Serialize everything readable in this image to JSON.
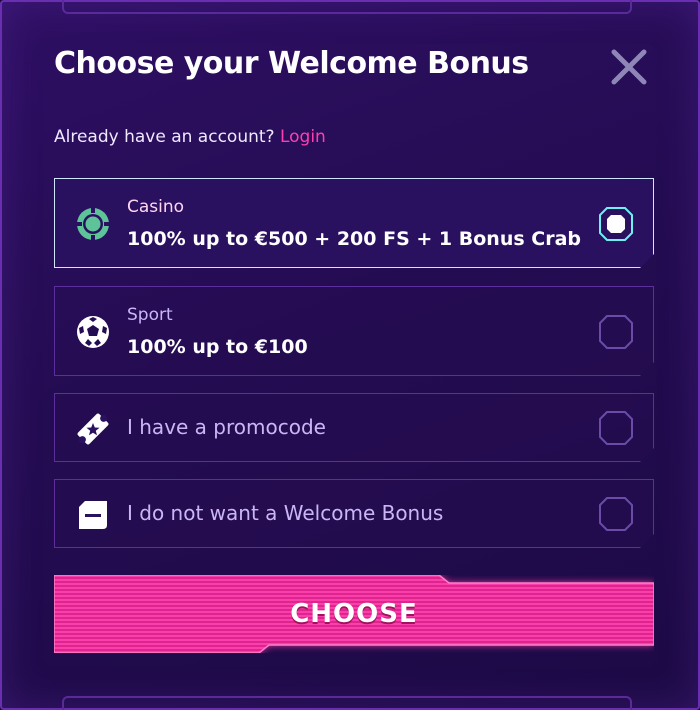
{
  "dialog": {
    "title": "Choose your Welcome Bonus",
    "subtitle_text": "Already have an account?",
    "login_link": "Login"
  },
  "options": [
    {
      "label": "Casino",
      "desc": "100% up to €500 + 200 FS + 1 Bonus Crab",
      "icon": "casino-chip-icon",
      "selected": true
    },
    {
      "label": "Sport",
      "desc": "100% up to €100",
      "icon": "soccer-ball-icon",
      "selected": false
    },
    {
      "label": "I have a promocode",
      "icon": "ticket-icon",
      "selected": false
    },
    {
      "label": "I do not want a Welcome Bonus",
      "icon": "no-bonus-icon",
      "selected": false
    }
  ],
  "choose_button": {
    "label": "CHOOSE"
  },
  "colors": {
    "accent_pink": "#ff3fae",
    "selected_border": "#cfe6ff",
    "background": "#240c52"
  }
}
